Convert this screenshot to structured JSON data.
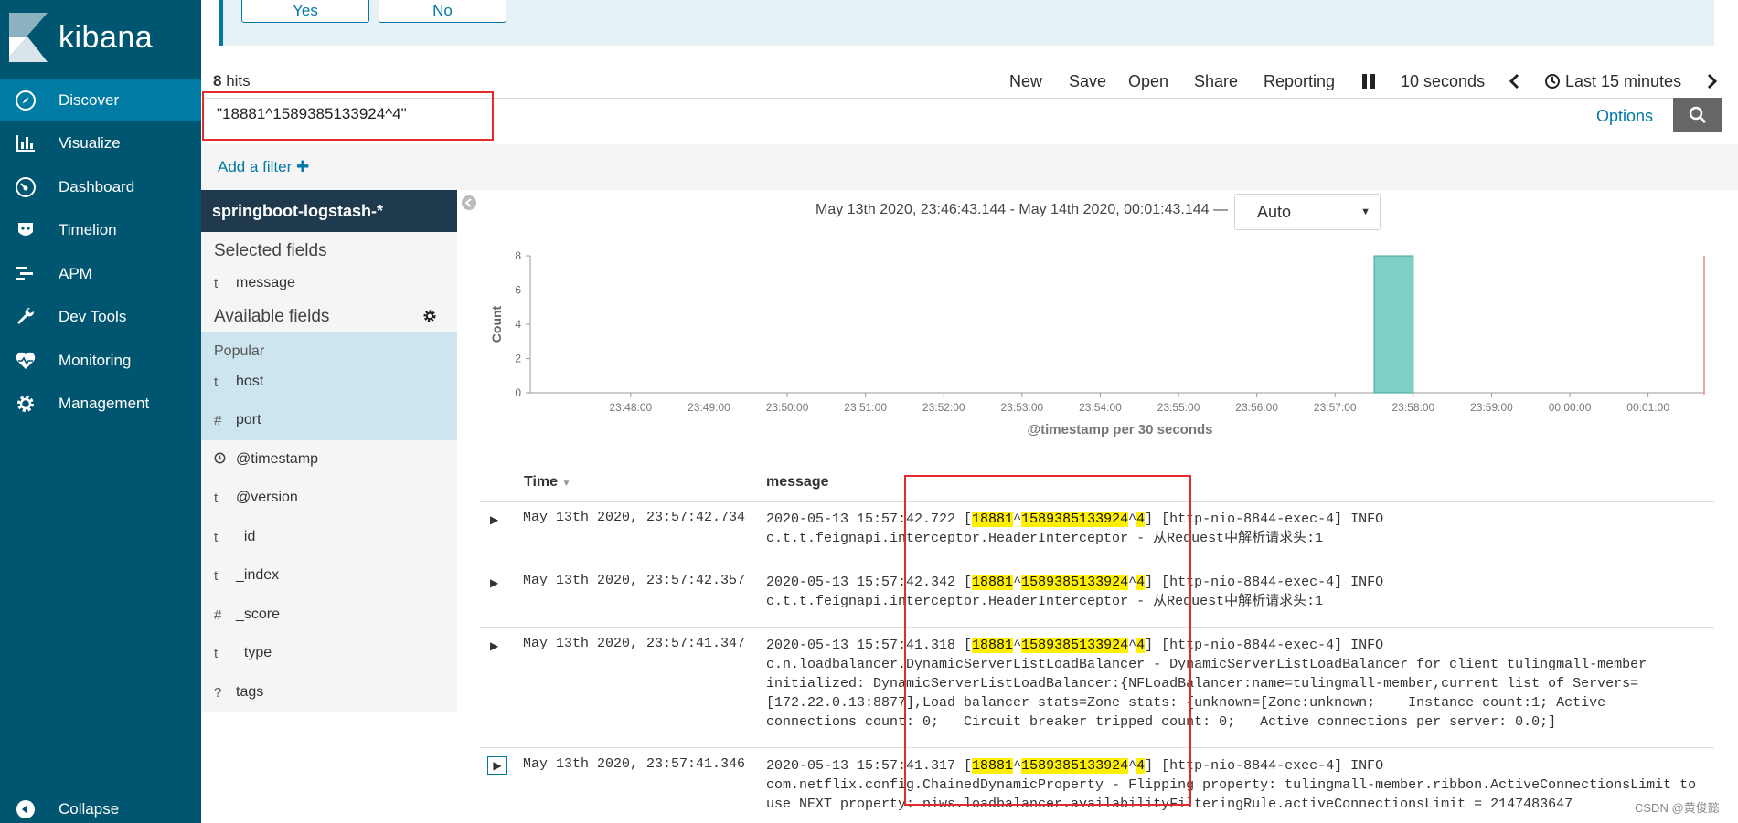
{
  "sidebar": {
    "brand": "kibana",
    "items": [
      {
        "label": "Discover",
        "icon": "compass-icon"
      },
      {
        "label": "Visualize",
        "icon": "bar-chart-icon"
      },
      {
        "label": "Dashboard",
        "icon": "dashboard-icon"
      },
      {
        "label": "Timelion",
        "icon": "timelion-icon"
      },
      {
        "label": "APM",
        "icon": "apm-icon"
      },
      {
        "label": "Dev Tools",
        "icon": "wrench-icon"
      },
      {
        "label": "Monitoring",
        "icon": "heartbeat-icon"
      },
      {
        "label": "Management",
        "icon": "gear-icon"
      }
    ],
    "collapse_label": "Collapse"
  },
  "confirm": {
    "yes": "Yes",
    "no": "No"
  },
  "hits": {
    "count": "8",
    "label": " hits"
  },
  "top_menu": {
    "new": "New",
    "save": "Save",
    "open": "Open",
    "share": "Share",
    "reporting": "Reporting",
    "refresh_interval": "10 seconds",
    "time_picker": "Last 15 minutes"
  },
  "query": {
    "value": "\"18881^1589385133924^4\"",
    "options": "Options"
  },
  "filter": {
    "add_label": "Add a filter"
  },
  "index_pattern": "springboot-logstash-*",
  "fields": {
    "selected_title": "Selected fields",
    "selected": [
      {
        "type": "t",
        "name": "message"
      }
    ],
    "available_title": "Available fields",
    "popular_label": "Popular",
    "popular": [
      {
        "type": "t",
        "name": "host"
      },
      {
        "type": "#",
        "name": "port"
      }
    ],
    "available": [
      {
        "type": "clock",
        "name": "@timestamp"
      },
      {
        "type": "t",
        "name": "@version"
      },
      {
        "type": "t",
        "name": "_id"
      },
      {
        "type": "t",
        "name": "_index"
      },
      {
        "type": "#",
        "name": "_score"
      },
      {
        "type": "t",
        "name": "_type"
      },
      {
        "type": "?",
        "name": "tags"
      }
    ]
  },
  "histogram": {
    "time_range": "May 13th 2020, 23:46:43.144 - May 14th 2020, 00:01:43.144 —",
    "interval": "Auto"
  },
  "chart_data": {
    "type": "bar",
    "ylabel": "Count",
    "xlabel": "@timestamp per 30 seconds",
    "ylim": [
      0,
      8
    ],
    "y_ticks": [
      "0",
      "2",
      "4",
      "6",
      "8"
    ],
    "x_ticks": [
      "23:48:00",
      "23:49:00",
      "23:50:00",
      "23:51:00",
      "23:52:00",
      "23:53:00",
      "23:54:00",
      "23:55:00",
      "23:56:00",
      "23:57:00",
      "23:58:00",
      "23:59:00",
      "00:00:00",
      "00:01:00"
    ],
    "bars": [
      {
        "x": "23:57:30",
        "value": 8
      }
    ],
    "bar_color": "#7fd0c7"
  },
  "table": {
    "col_time": "Time",
    "col_message": "message",
    "rows": [
      {
        "time": "May 13th 2020, 23:57:42.734",
        "ts": "2020-05-13 15:57:42.722 [",
        "h1": "18881",
        "s1": "^",
        "h2": "1589385133924",
        "s2": "^",
        "h3": "4",
        "rest": "] [http-nio-8844-exec-4] INFO\nc.t.t.feignapi.interceptor.HeaderInterceptor - 从Request中解析请求头:1"
      },
      {
        "time": "May 13th 2020, 23:57:42.357",
        "ts": "2020-05-13 15:57:42.342 [",
        "h1": "18881",
        "s1": "^",
        "h2": "1589385133924",
        "s2": "^",
        "h3": "4",
        "rest": "] [http-nio-8844-exec-4] INFO\nc.t.t.feignapi.interceptor.HeaderInterceptor - 从Request中解析请求头:1"
      },
      {
        "time": "May 13th 2020, 23:57:41.347",
        "ts": "2020-05-13 15:57:41.318 [",
        "h1": "18881",
        "s1": "^",
        "h2": "1589385133924",
        "s2": "^",
        "h3": "4",
        "rest": "] [http-nio-8844-exec-4] INFO\nc.n.loadbalancer.DynamicServerListLoadBalancer - DynamicServerListLoadBalancer for client tulingmall-member\ninitialized: DynamicServerListLoadBalancer:{NFLoadBalancer:name=tulingmall-member,current list of Servers=\n[172.22.0.13:8877],Load balancer stats=Zone stats: {unknown=[Zone:unknown;\tInstance count:1;\tActive\nconnections count: 0;\tCircuit breaker tripped count: 0;\tActive connections per server: 0.0;]"
      },
      {
        "time": "May 13th 2020, 23:57:41.346",
        "ts": "2020-05-13 15:57:41.317 [",
        "h1": "18881",
        "s1": "^",
        "h2": "1589385133924",
        "s2": "^",
        "h3": "4",
        "rest": "] [http-nio-8844-exec-4] INFO\ncom.netflix.config.ChainedDynamicProperty - Flipping property: tulingmall-member.ribbon.ActiveConnectionsLimit to\nuse NEXT property: niws.loadbalancer.availabilityFilteringRule.activeConnectionsLimit = 2147483647"
      }
    ]
  },
  "watermark": "CSDN @黄俊懿"
}
